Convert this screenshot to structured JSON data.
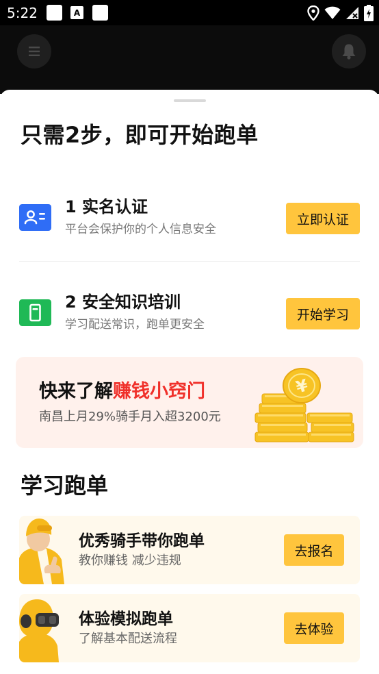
{
  "status_bar": {
    "time": "5:22",
    "left_icons": [
      "app-notification-icon",
      "a-letter-icon",
      "app-notification-icon"
    ],
    "right_icons": [
      "location-icon",
      "wifi-icon",
      "cellular-signal-icon",
      "battery-icon"
    ]
  },
  "top_bar": {
    "menu_icon": "menu-icon",
    "bell_icon": "bell-icon"
  },
  "sheet": {
    "title": "只需2步，即可开始跑单",
    "steps": [
      {
        "icon": "id-card-icon",
        "icon_color": "#2f6df6",
        "title": "1 实名认证",
        "subtitle": "平台会保护你的个人信息安全",
        "button": "立即认证"
      },
      {
        "icon": "document-icon",
        "icon_color": "#1fb956",
        "title": "2 安全知识培训",
        "subtitle": "学习配送常识，跑单更安全",
        "button": "开始学习"
      }
    ],
    "promo": {
      "title_prefix": "快来了解",
      "title_highlight": "赚钱小窍门",
      "subtitle": "南昌上月29%骑手月入超3200元",
      "image": "gold-coins-illustration",
      "highlight_color": "#f0302a"
    },
    "learn_section": {
      "title": "学习跑单",
      "cards": [
        {
          "image": "rider-thumbs-up-illustration",
          "title": "优秀骑手带你跑单",
          "subtitle": "教你赚钱 减少违规",
          "button": "去报名"
        },
        {
          "image": "rider-vr-headset-illustration",
          "title": "体验模拟跑单",
          "subtitle": "了解基本配送流程",
          "button": "去体验"
        }
      ]
    }
  },
  "colors": {
    "accent_button": "#ffc53d",
    "promo_background": "#fff1ec",
    "learn_card_background": "#fff9ec"
  }
}
